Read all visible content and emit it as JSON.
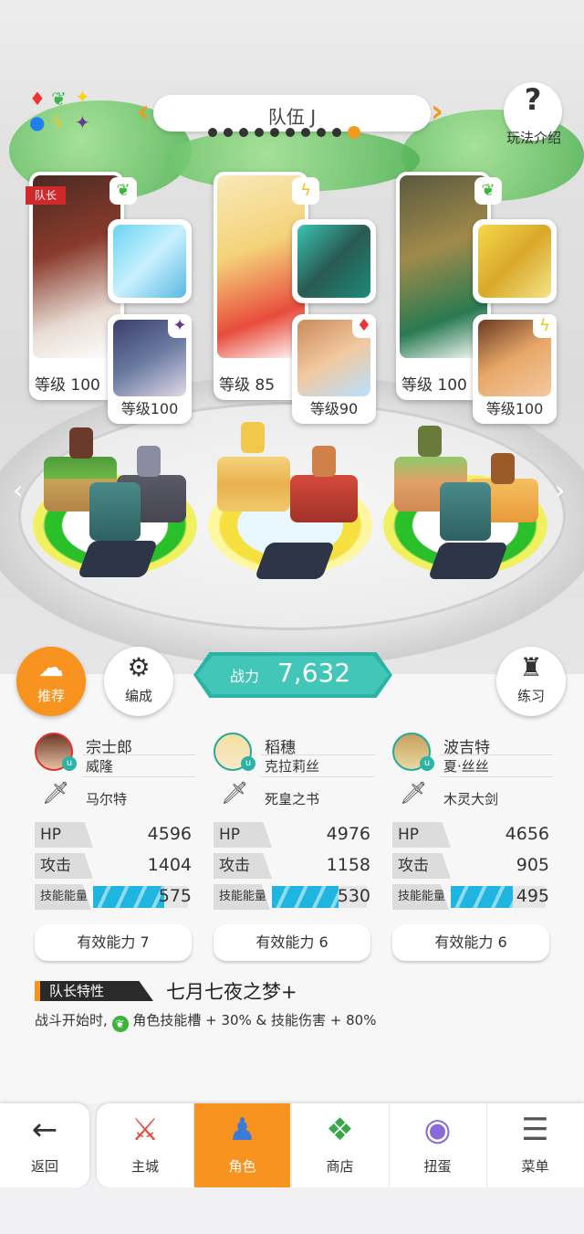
{
  "team": {
    "title": "队伍 J",
    "page_count": 10,
    "active_page": 10
  },
  "help": {
    "label": "玩法介绍"
  },
  "leader_tag": "队长",
  "heroes": [
    {
      "level_label": "等级 100",
      "element": "leaf",
      "sub_level_label": "等级100",
      "sub_element": "dark"
    },
    {
      "level_label": "等级 85",
      "element": "lightning",
      "sub_level_label": "等级90",
      "sub_element": "diamond"
    },
    {
      "level_label": "等级 100",
      "element": "leaf",
      "sub_level_label": "等级100",
      "sub_element": "lightning"
    }
  ],
  "buttons": {
    "recommend": "推荐",
    "formation": "编成",
    "practice": "练习"
  },
  "power": {
    "label": "战力",
    "value": "7,632"
  },
  "members": [
    {
      "name": "宗士郎",
      "sub": "威隆",
      "weapon": "马尔特",
      "hp": "4596",
      "atk": "1404",
      "energy": "575",
      "energy_fill": 0.75,
      "ability": "有效能力 7"
    },
    {
      "name": "稻穗",
      "sub": "克拉莉丝",
      "weapon": "死皇之书",
      "hp": "4976",
      "atk": "1158",
      "energy": "530",
      "energy_fill": 0.7,
      "ability": "有效能力 6"
    },
    {
      "name": "波吉特",
      "sub": "夏·丝丝",
      "weapon": "木灵大剑",
      "hp": "4656",
      "atk": "905",
      "energy": "495",
      "energy_fill": 0.65,
      "ability": "有效能力 6"
    }
  ],
  "stat_labels": {
    "hp": "HP",
    "atk": "攻击",
    "energy": "技能能量"
  },
  "leader_skill": {
    "label": "队长特性",
    "name": "七月七夜之梦+",
    "desc_pre": "战斗开始时,",
    "desc_post": "角色技能槽 + 30% & 技能伤害 + 80%"
  },
  "nav": {
    "back": "返回",
    "tabs": [
      "主城",
      "角色",
      "商店",
      "扭蛋",
      "菜单"
    ],
    "active": "角色"
  },
  "colors": {
    "accent": "#f7931e",
    "teal": "#2bb3a6",
    "leader_red": "#d0292c"
  }
}
